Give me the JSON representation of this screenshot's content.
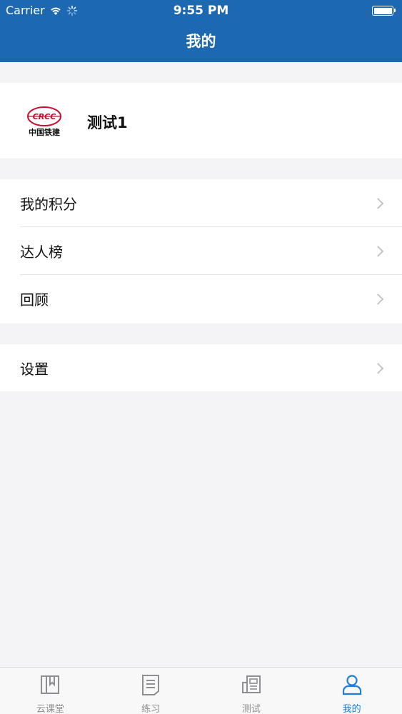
{
  "status_bar": {
    "carrier": "Carrier",
    "time": "9:55 PM"
  },
  "header": {
    "title": "我的"
  },
  "profile": {
    "name": "测试1",
    "logo_text": "中国铁建",
    "logo_mark": "CRCC"
  },
  "menu": {
    "group1": [
      {
        "label": "我的积分"
      },
      {
        "label": "达人榜"
      },
      {
        "label": "回顾"
      }
    ],
    "group2": [
      {
        "label": "设置"
      }
    ]
  },
  "tabbar": {
    "tabs": [
      {
        "label": "云课堂",
        "icon": "book-icon"
      },
      {
        "label": "练习",
        "icon": "document-icon"
      },
      {
        "label": "测试",
        "icon": "newspaper-icon"
      },
      {
        "label": "我的",
        "icon": "person-icon",
        "active": true
      }
    ]
  },
  "colors": {
    "brand": "#1c68b1",
    "active_tab": "#1c7ed6",
    "inactive_tab": "#8e8e93",
    "logo_red": "#c8102e"
  }
}
